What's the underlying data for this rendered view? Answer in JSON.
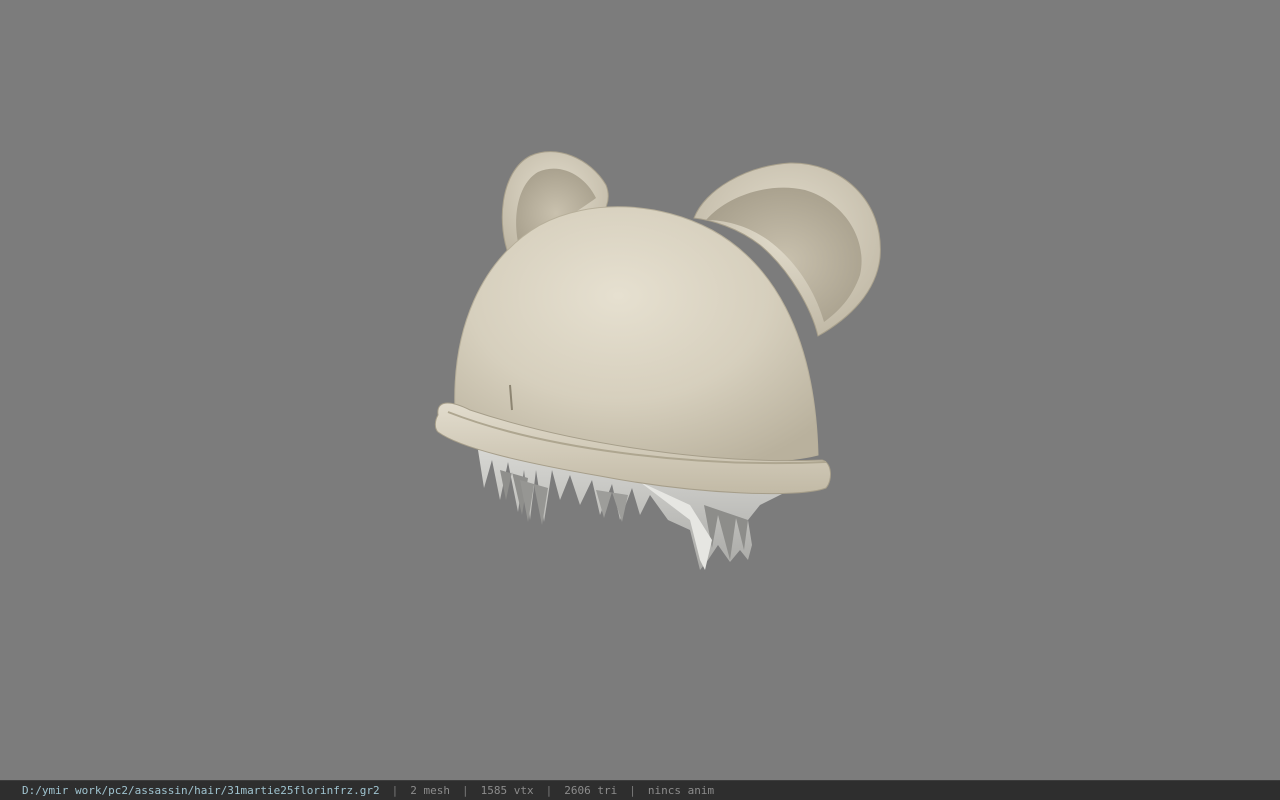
{
  "statusbar": {
    "file_path": "D:/ymir work/pc2/assassin/hair/31martie25florinfrz.gr2",
    "separator": "|",
    "mesh_count": "2 mesh",
    "vertex_count": "1585 vtx",
    "triangle_count": "2606 tri",
    "animation": "nincs anim"
  },
  "colors": {
    "viewport_background": "#7c7c7c",
    "model_base": "#d8d1c0",
    "statusbar_background": "#2e2e2e",
    "path_text": "#9fc3cf"
  }
}
